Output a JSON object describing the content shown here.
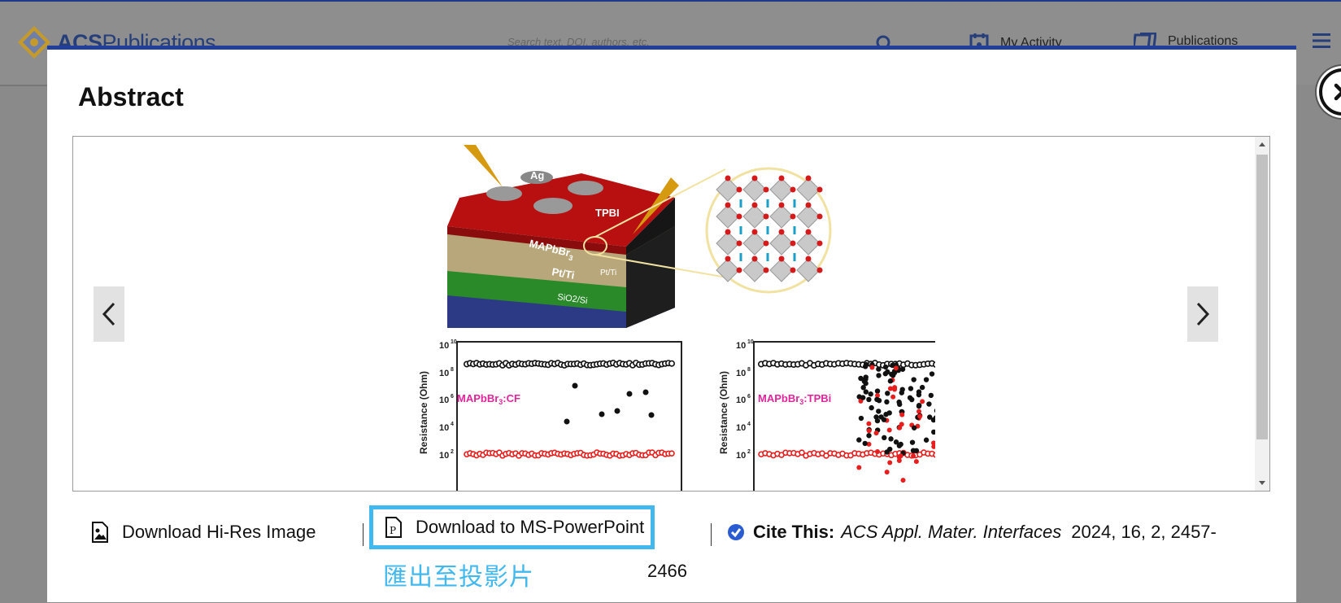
{
  "site": {
    "logo_acs": "ACS",
    "logo_publications": "Publications",
    "search_placeholder": "Search text, DOI, authors, etc.",
    "nav_my_activity": "My Activity",
    "nav_publications": "Publications"
  },
  "modal": {
    "title": "Abstract",
    "figure": {
      "labels": {
        "ag": "Ag",
        "tpbi": "TPBI",
        "mapbbr": "MAPbBr",
        "mapbbr_sub": "3",
        "pt_ti": "Pt/Ti",
        "pt_ti_small": "Pt/Ti",
        "sio2_si": "SiO2/Si",
        "plot1_label": "MAPbBr",
        "plot1_sub": "3",
        "plot1_suffix": ":CF",
        "plot2_label": "MAPbBr",
        "plot2_sub": "3",
        "plot2_suffix": ":TPBi",
        "ylabel": "Resistance (Ohm)",
        "yticks": [
          "10",
          "10",
          "10",
          "10",
          "10"
        ],
        "yexps": [
          "10",
          "8",
          "6",
          "4",
          "2"
        ]
      }
    },
    "actions": {
      "download_hires": "Download Hi-Res Image",
      "download_ppt": "Download to MS-PowerPoint",
      "cite_label": "Cite This:",
      "cite_journal": "ACS Appl. Mater. Interfaces",
      "cite_details": "2024, 16, 2, 2457-",
      "cite_pages_end": "2466",
      "ppt_caption_zh": "匯出至投影片"
    }
  },
  "colors": {
    "accent_blue": "#41b9ef",
    "modal_border": "#1f3f9b",
    "magenta_label": "#e0249a",
    "red_point": "#e81e1e"
  }
}
